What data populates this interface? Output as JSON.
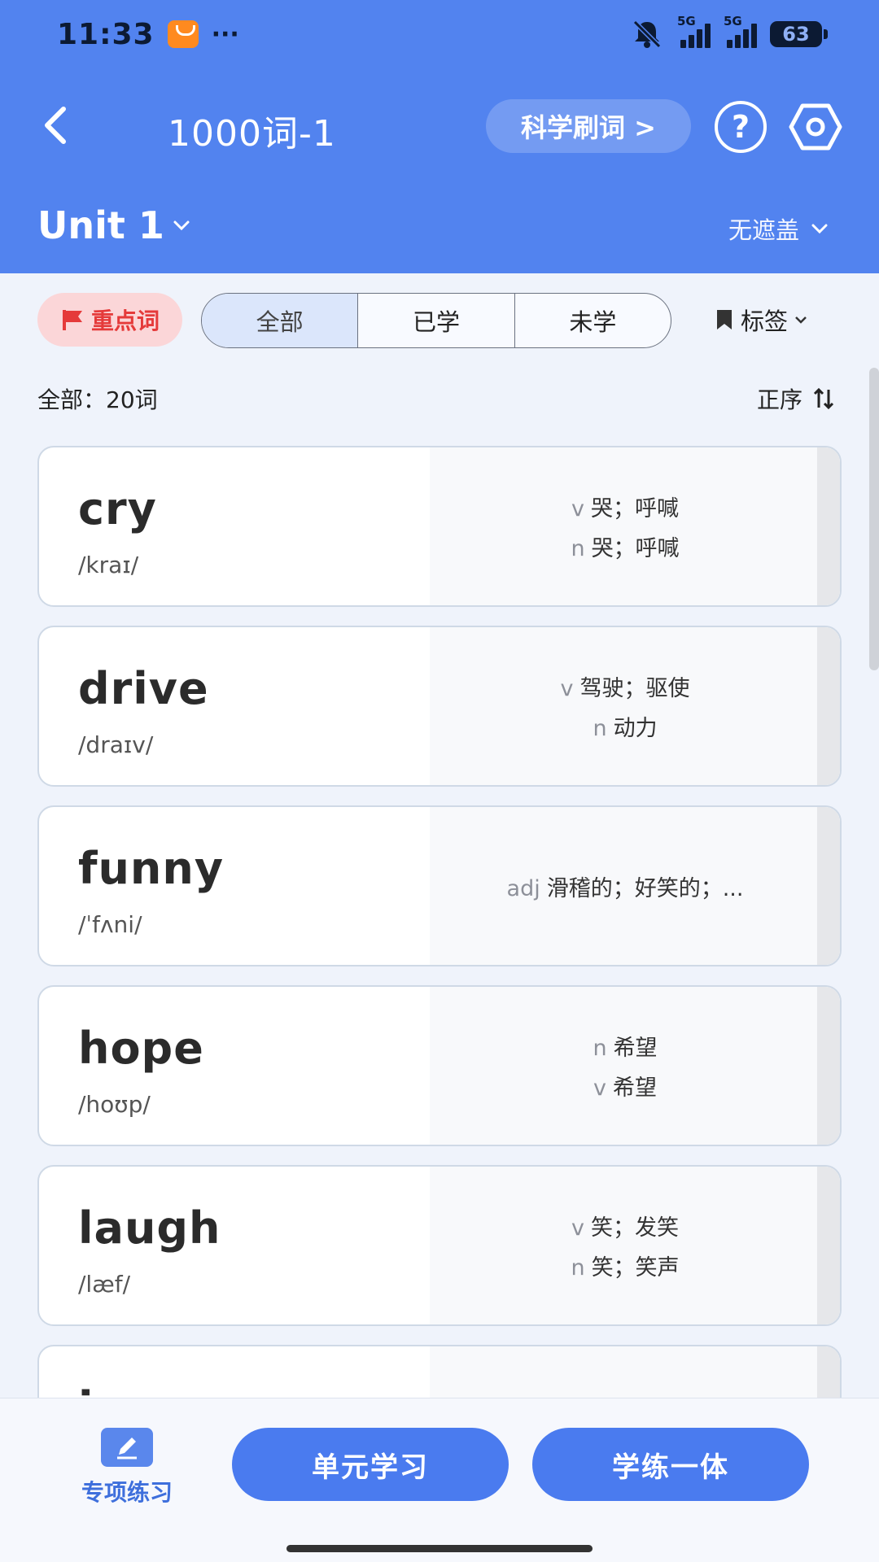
{
  "status": {
    "time": "11:33",
    "more": "···",
    "network1": "5G",
    "network2": "5G",
    "battery": "63"
  },
  "nav": {
    "title": "1000词-1",
    "scientific_label": "科学刷词 >",
    "help_label": "?"
  },
  "unit": {
    "name": "Unit 1",
    "cover_mode": "无遮盖"
  },
  "filters": {
    "key_words": "重点词",
    "segments": [
      "全部",
      "已学",
      "未学"
    ],
    "active_segment": 0,
    "tag_label": "标签"
  },
  "summary": {
    "count_label": "全部：20词",
    "sort_label": "正序"
  },
  "words": [
    {
      "word": "cry",
      "phonetic": "/kraɪ/",
      "defs": [
        {
          "pos": "v",
          "text": "哭；呼喊"
        },
        {
          "pos": "n",
          "text": "哭；呼喊"
        }
      ]
    },
    {
      "word": "drive",
      "phonetic": "/draɪv/",
      "defs": [
        {
          "pos": "v",
          "text": "驾驶；驱使"
        },
        {
          "pos": "n",
          "text": "动力"
        }
      ]
    },
    {
      "word": "funny",
      "phonetic": "/ˈfʌni/",
      "defs": [
        {
          "pos": "adj",
          "text": "滑稽的；好笑的；..."
        }
      ]
    },
    {
      "word": "hope",
      "phonetic": "/hoʊp/",
      "defs": [
        {
          "pos": "n",
          "text": "希望"
        },
        {
          "pos": "v",
          "text": "希望"
        }
      ]
    },
    {
      "word": "laugh",
      "phonetic": "/læf/",
      "defs": [
        {
          "pos": "v",
          "text": "笑；发笑"
        },
        {
          "pos": "n",
          "text": "笑；笑声"
        }
      ]
    },
    {
      "word": "i",
      "phonetic": "",
      "defs": []
    }
  ],
  "bottom": {
    "practice_label": "专项练习",
    "unit_study": "单元学习",
    "learn_practice": "学练一体"
  },
  "colors": {
    "header": "#5283ef",
    "primary_button": "#4a7bef",
    "key_word_red": "#e53a3a"
  }
}
